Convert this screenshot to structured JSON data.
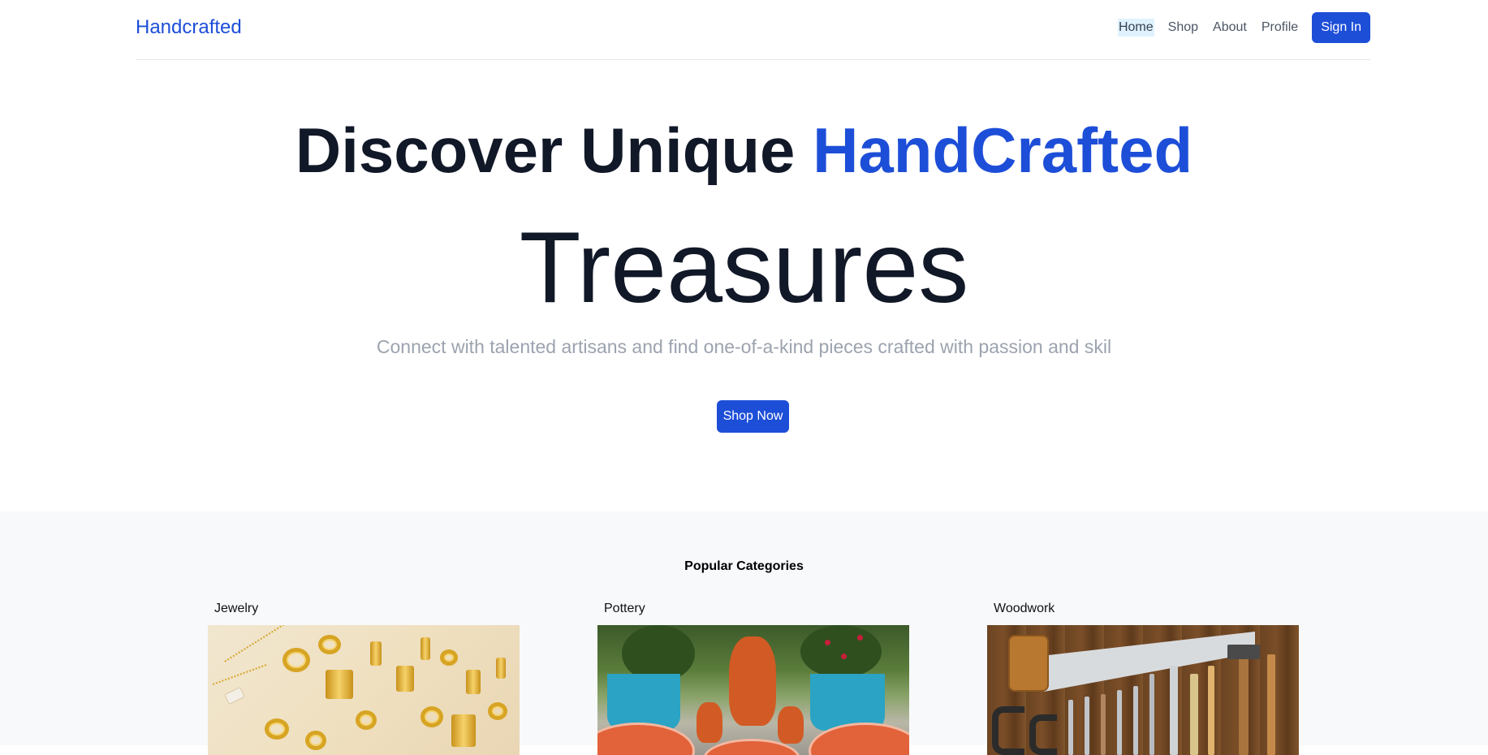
{
  "nav": {
    "brand": "Handcrafted",
    "links": [
      "Home",
      "Shop",
      "About",
      "Profile"
    ],
    "active_link": "Home",
    "signin_label": "Sign In"
  },
  "hero": {
    "title_part1": "Discover Unique ",
    "title_accent": "HandCrafted",
    "title_line2": "Treasures",
    "subtitle": "Connect with talented artisans and find one-of-a-kind pieces crafted with passion and skil",
    "cta_label": "Shop Now"
  },
  "categories": {
    "title": "Popular Categories",
    "items": [
      {
        "label": "Jewelry",
        "image": "jewelry-image"
      },
      {
        "label": "Pottery",
        "image": "pottery-image"
      },
      {
        "label": "Woodwork",
        "image": "woodwork-image"
      }
    ]
  },
  "colors": {
    "accent": "#1d4ed8",
    "text": "#111827",
    "muted": "#9ca3af",
    "section_bg": "#f8f9fb"
  }
}
